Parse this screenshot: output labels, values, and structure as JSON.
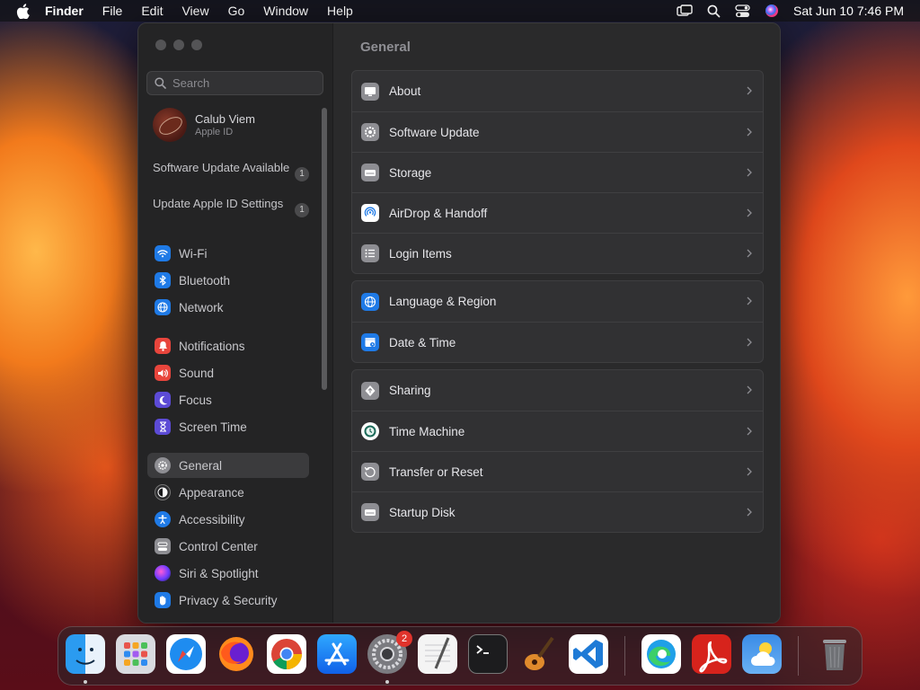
{
  "menubar": {
    "app_name": "Finder",
    "items": [
      "File",
      "Edit",
      "View",
      "Go",
      "Window",
      "Help"
    ],
    "clock": "Sat Jun 10  7:46 PM",
    "status_icons": [
      "screen-mirroring-icon",
      "spotlight-search-icon",
      "control-center-icon",
      "siri-icon"
    ]
  },
  "window": {
    "search": {
      "placeholder": "Search"
    },
    "profile": {
      "name": "Calub Viem",
      "subtitle": "Apple ID"
    },
    "notices": [
      {
        "label": "Software Update Available",
        "badge": "1"
      },
      {
        "label": "Update Apple ID Settings",
        "badge": "1"
      }
    ],
    "sidebar_items": [
      {
        "label": "Wi-Fi",
        "icon": "wifi-icon",
        "color": "#1f7ae6"
      },
      {
        "label": "Bluetooth",
        "icon": "bluetooth-icon",
        "color": "#1f7ae6"
      },
      {
        "label": "Network",
        "icon": "network-globe-icon",
        "color": "#1f7ae6"
      },
      {
        "label": "Notifications",
        "icon": "bell-icon",
        "color": "#e8453c"
      },
      {
        "label": "Sound",
        "icon": "speaker-icon",
        "color": "#e8453c"
      },
      {
        "label": "Focus",
        "icon": "moon-icon",
        "color": "#5c4bd6"
      },
      {
        "label": "Screen Time",
        "icon": "hourglass-icon",
        "color": "#5c4bd6"
      },
      {
        "label": "General",
        "icon": "gear-icon",
        "color": "#8e8e93",
        "active": true
      },
      {
        "label": "Appearance",
        "icon": "appearance-icon",
        "color": "#2c2c2e"
      },
      {
        "label": "Accessibility",
        "icon": "accessibility-icon",
        "color": "#1f7ae6"
      },
      {
        "label": "Control Center",
        "icon": "control-center-icon",
        "color": "#8e8e93"
      },
      {
        "label": "Siri & Spotlight",
        "icon": "siri-icon",
        "color": "#7a3fd6"
      },
      {
        "label": "Privacy & Security",
        "icon": "hand-icon",
        "color": "#1f7ae6"
      }
    ],
    "content_title": "General",
    "groups": [
      [
        {
          "label": "About",
          "icon": "display-icon",
          "color": "#8e8e93"
        },
        {
          "label": "Software Update",
          "icon": "gear-badge-icon",
          "color": "#8e8e93"
        },
        {
          "label": "Storage",
          "icon": "drive-icon",
          "color": "#8e8e93"
        },
        {
          "label": "AirDrop & Handoff",
          "icon": "airdrop-icon",
          "color": "#ffffff"
        },
        {
          "label": "Login Items",
          "icon": "list-icon",
          "color": "#8e8e93"
        }
      ],
      [
        {
          "label": "Language & Region",
          "icon": "globe-icon",
          "color": "#1f7ae6"
        },
        {
          "label": "Date & Time",
          "icon": "calendar-clock-icon",
          "color": "#1f7ae6"
        }
      ],
      [
        {
          "label": "Sharing",
          "icon": "sharing-icon",
          "color": "#8e8e93"
        },
        {
          "label": "Time Machine",
          "icon": "time-machine-icon",
          "color": "#ffffff"
        },
        {
          "label": "Transfer or Reset",
          "icon": "reset-icon",
          "color": "#8e8e93"
        },
        {
          "label": "Startup Disk",
          "icon": "disk-icon",
          "color": "#8e8e93"
        }
      ]
    ]
  },
  "dock": {
    "apps": [
      {
        "name": "finder-app-icon",
        "running": true
      },
      {
        "name": "launchpad-app-icon"
      },
      {
        "name": "safari-app-icon"
      },
      {
        "name": "firefox-app-icon"
      },
      {
        "name": "chrome-app-icon"
      },
      {
        "name": "app-store-app-icon"
      },
      {
        "name": "system-settings-app-icon",
        "running": true,
        "badge": "2"
      },
      {
        "name": "textedit-app-icon"
      },
      {
        "name": "terminal-app-icon"
      },
      {
        "name": "garageband-app-icon"
      },
      {
        "name": "vscode-app-icon"
      },
      {
        "name": "edge-app-icon"
      },
      {
        "name": "acrobat-app-icon"
      },
      {
        "name": "weather-app-icon"
      },
      {
        "name": "trash-app-icon"
      }
    ]
  }
}
